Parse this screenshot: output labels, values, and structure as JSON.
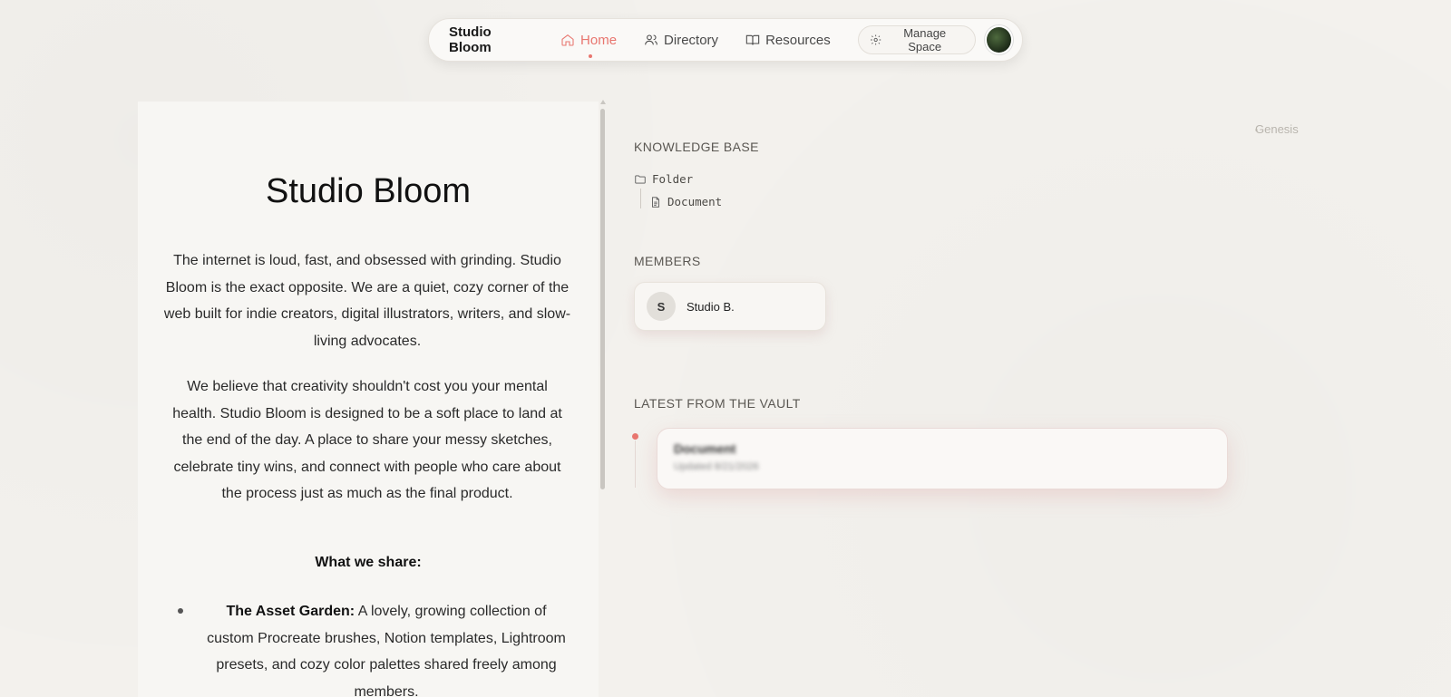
{
  "nav": {
    "brand": "Studio Bloom",
    "items": [
      {
        "label": "Home",
        "icon": "home-icon",
        "active": true
      },
      {
        "label": "Directory",
        "icon": "users-icon",
        "active": false
      },
      {
        "label": "Resources",
        "icon": "book-icon",
        "active": false
      }
    ],
    "manage_label": "Manage Space",
    "accent_color": "#e8766f"
  },
  "main": {
    "title": "Studio Bloom",
    "paragraphs": [
      "The internet is loud, fast, and obsessed with grinding. Studio Bloom is the exact opposite. We are a quiet, cozy corner of the web built for indie creators, digital illustrators, writers, and slow-living advocates.",
      "We believe that creativity shouldn't cost you your mental health. Studio Bloom is designed to be a soft place to land at the end of the day. A place to share your messy sketches, celebrate tiny wins, and connect with people who care about the process just as much as the final product."
    ],
    "share_heading": "What we share:",
    "bullets": [
      {
        "bold": "The Asset Garden:",
        "text": " A lovely, growing collection of custom Procreate brushes, Notion templates, Lightroom presets, and cozy color palettes shared freely among members."
      }
    ]
  },
  "sidebar": {
    "genesis": "Genesis",
    "knowledge_base": {
      "label": "KNOWLEDGE BASE",
      "folder": "Folder",
      "document": "Document"
    },
    "members": {
      "label": "MEMBERS",
      "items": [
        {
          "initial": "S",
          "name": "Studio B."
        }
      ]
    },
    "vault": {
      "label": "LATEST FROM THE VAULT",
      "items": [
        {
          "title": "Document",
          "meta": "Updated 8/21/2026"
        }
      ]
    }
  }
}
